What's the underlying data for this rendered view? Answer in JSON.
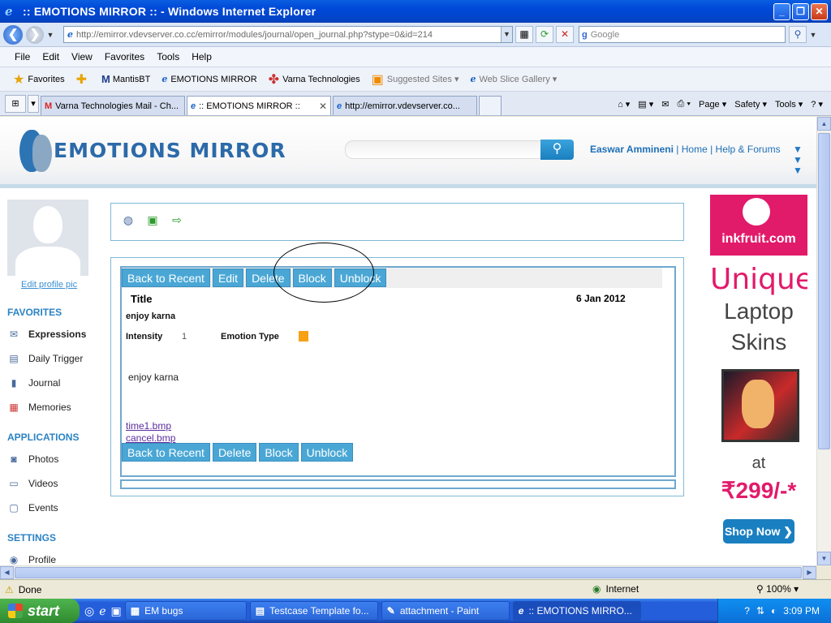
{
  "window": {
    "title": ":: EMOTIONS MIRROR :: - Windows Internet Explorer",
    "minimize": "_",
    "restore": "❐",
    "close": "✕"
  },
  "address": {
    "back": "❮",
    "forward": "❯",
    "url": "http://emirror.vdevserver.co.cc/emirror/modules/journal/open_journal.php?stype=0&id=214",
    "search_placeholder": "Google"
  },
  "menu": [
    "File",
    "Edit",
    "View",
    "Favorites",
    "Tools",
    "Help"
  ],
  "favorites_bar": {
    "favorites_label": "Favorites",
    "links": [
      {
        "label": "MantisBT"
      },
      {
        "label": "EMOTIONS MIRROR"
      },
      {
        "label": "Varna Technologies"
      },
      {
        "label": "Suggested Sites ▾"
      },
      {
        "label": "Web Slice Gallery ▾"
      }
    ]
  },
  "tabs": [
    {
      "label": "Varna Technologies Mail - Ch..."
    },
    {
      "label": ":: EMOTIONS MIRROR ::"
    },
    {
      "label": "http://emirror.vdevserver.co..."
    }
  ],
  "command_bar": {
    "page": "Page ▾",
    "safety": "Safety ▾",
    "tools": "Tools ▾"
  },
  "site": {
    "logo_text": "EMOTIONS MIRROR",
    "user": "Easwar Ammineni",
    "link_home": "Home",
    "link_help": "Help & Forums",
    "edit_pic": "Edit profile pic",
    "favorites_heading": "FAVORITES",
    "applications_heading": "APPLICATIONS",
    "settings_heading": "SETTINGS",
    "favorites": [
      "Expressions",
      "Daily Trigger",
      "Journal",
      "Memories"
    ],
    "applications": [
      "Photos",
      "Videos",
      "Events"
    ],
    "settings": [
      "Profile"
    ]
  },
  "entry": {
    "buttons_top": [
      "Back to Recent",
      "Edit",
      "Delete",
      "Block",
      "Unblock"
    ],
    "buttons_bottom": [
      "Back to Recent",
      "Delete",
      "Block",
      "Unblock"
    ],
    "title": "Title",
    "date": "6 Jan 2012",
    "subtitle": "enjoy karna",
    "intensity_label": "Intensity",
    "intensity_value": "1",
    "emotion_type_label": "Emotion Type",
    "emotion_color": "#f7a116",
    "body": "enjoy karna",
    "attachments": [
      "time1.bmp",
      "cancel.bmp"
    ]
  },
  "ad": {
    "brand": "inkfruit.com",
    "line1": "Unique",
    "line2": "Laptop",
    "line3": "Skins",
    "line4": "at",
    "price": "₹299/-*",
    "cta": "Shop Now ❯"
  },
  "status": {
    "text": "Done",
    "zone": "Internet",
    "zoom": "100%"
  },
  "taskbar": {
    "start": "start",
    "tasks": [
      "EM bugs",
      "Testcase Template fo...",
      "attachment - Paint",
      ":: EMOTIONS MIRRO..."
    ],
    "clock": "3:09 PM"
  }
}
